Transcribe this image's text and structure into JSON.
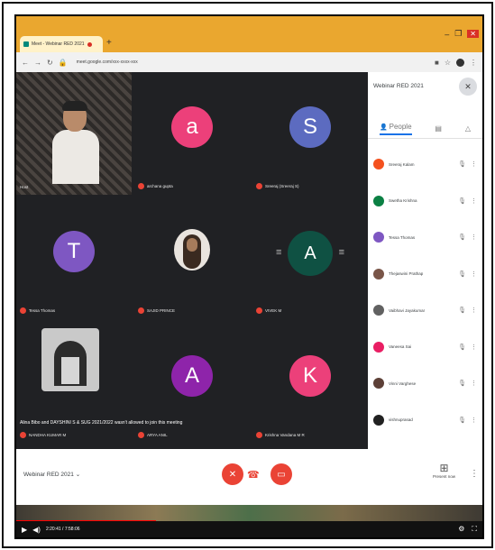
{
  "browser": {
    "tab_title": "Meet - Webinar RED 2021",
    "new_tab_icon": "plus-icon",
    "url": "meet.google.com/xxx-xxxx-xxx",
    "win_controls": [
      "–",
      "❐",
      "✕"
    ]
  },
  "meeting": {
    "name": "Webinar RED 2021",
    "notice": "Alina Bibo and DAYSHINI S & SUG 2021/2022 wasn't allowed to join this meeting",
    "tiles": [
      {
        "type": "video",
        "name": "Host"
      },
      {
        "type": "letter",
        "letter": "a",
        "color": "#ec407a",
        "name": "archana gupta"
      },
      {
        "type": "letter",
        "letter": "S",
        "color": "#5c6bc0",
        "name": "Sreeraj (Sreeraj S)"
      },
      {
        "type": "letter",
        "letter": "T",
        "color": "#7e57c2",
        "name": "Tessa Thomas"
      },
      {
        "type": "photo",
        "name": "SAJID PRINCE"
      },
      {
        "type": "letter",
        "letter": "A",
        "color": "#0f5143",
        "name": "VIVEK M"
      },
      {
        "type": "image",
        "name": "NANDHA KUMAR M"
      },
      {
        "type": "letter",
        "letter": "A",
        "color": "#8e24aa",
        "name": "ARYA ANIL"
      },
      {
        "type": "letter",
        "letter": "K",
        "color": "#ec407a",
        "name": "Krishna Vandana M R"
      }
    ]
  },
  "sidebar": {
    "title": "Webinar RED 2021",
    "tabs": [
      "People",
      "Chat",
      "Activities"
    ],
    "participants": [
      {
        "name": "Sreeraj Kalam",
        "color": "#f4511e"
      },
      {
        "name": "Swetha Krishna",
        "color": "#0b8043"
      },
      {
        "name": "Tessa Thomas",
        "color": "#7e57c2"
      },
      {
        "name": "Thejaswini Prathap",
        "color": "#795548"
      },
      {
        "name": "Vaibhavi Jayakumar",
        "color": "#616161"
      },
      {
        "name": "Vaneesa Sai",
        "color": "#e91e63"
      },
      {
        "name": "Vinni Varghese",
        "color": "#5d4037"
      },
      {
        "name": "vishnuprasad",
        "color": "#212121"
      }
    ]
  },
  "controls": {
    "mic_icon": "mic-off-icon",
    "end_icon": "end-call-icon",
    "cam_icon": "camera-off-icon",
    "present_label": "Present now"
  },
  "player": {
    "time": "2:20:41 / 7:58:06"
  }
}
